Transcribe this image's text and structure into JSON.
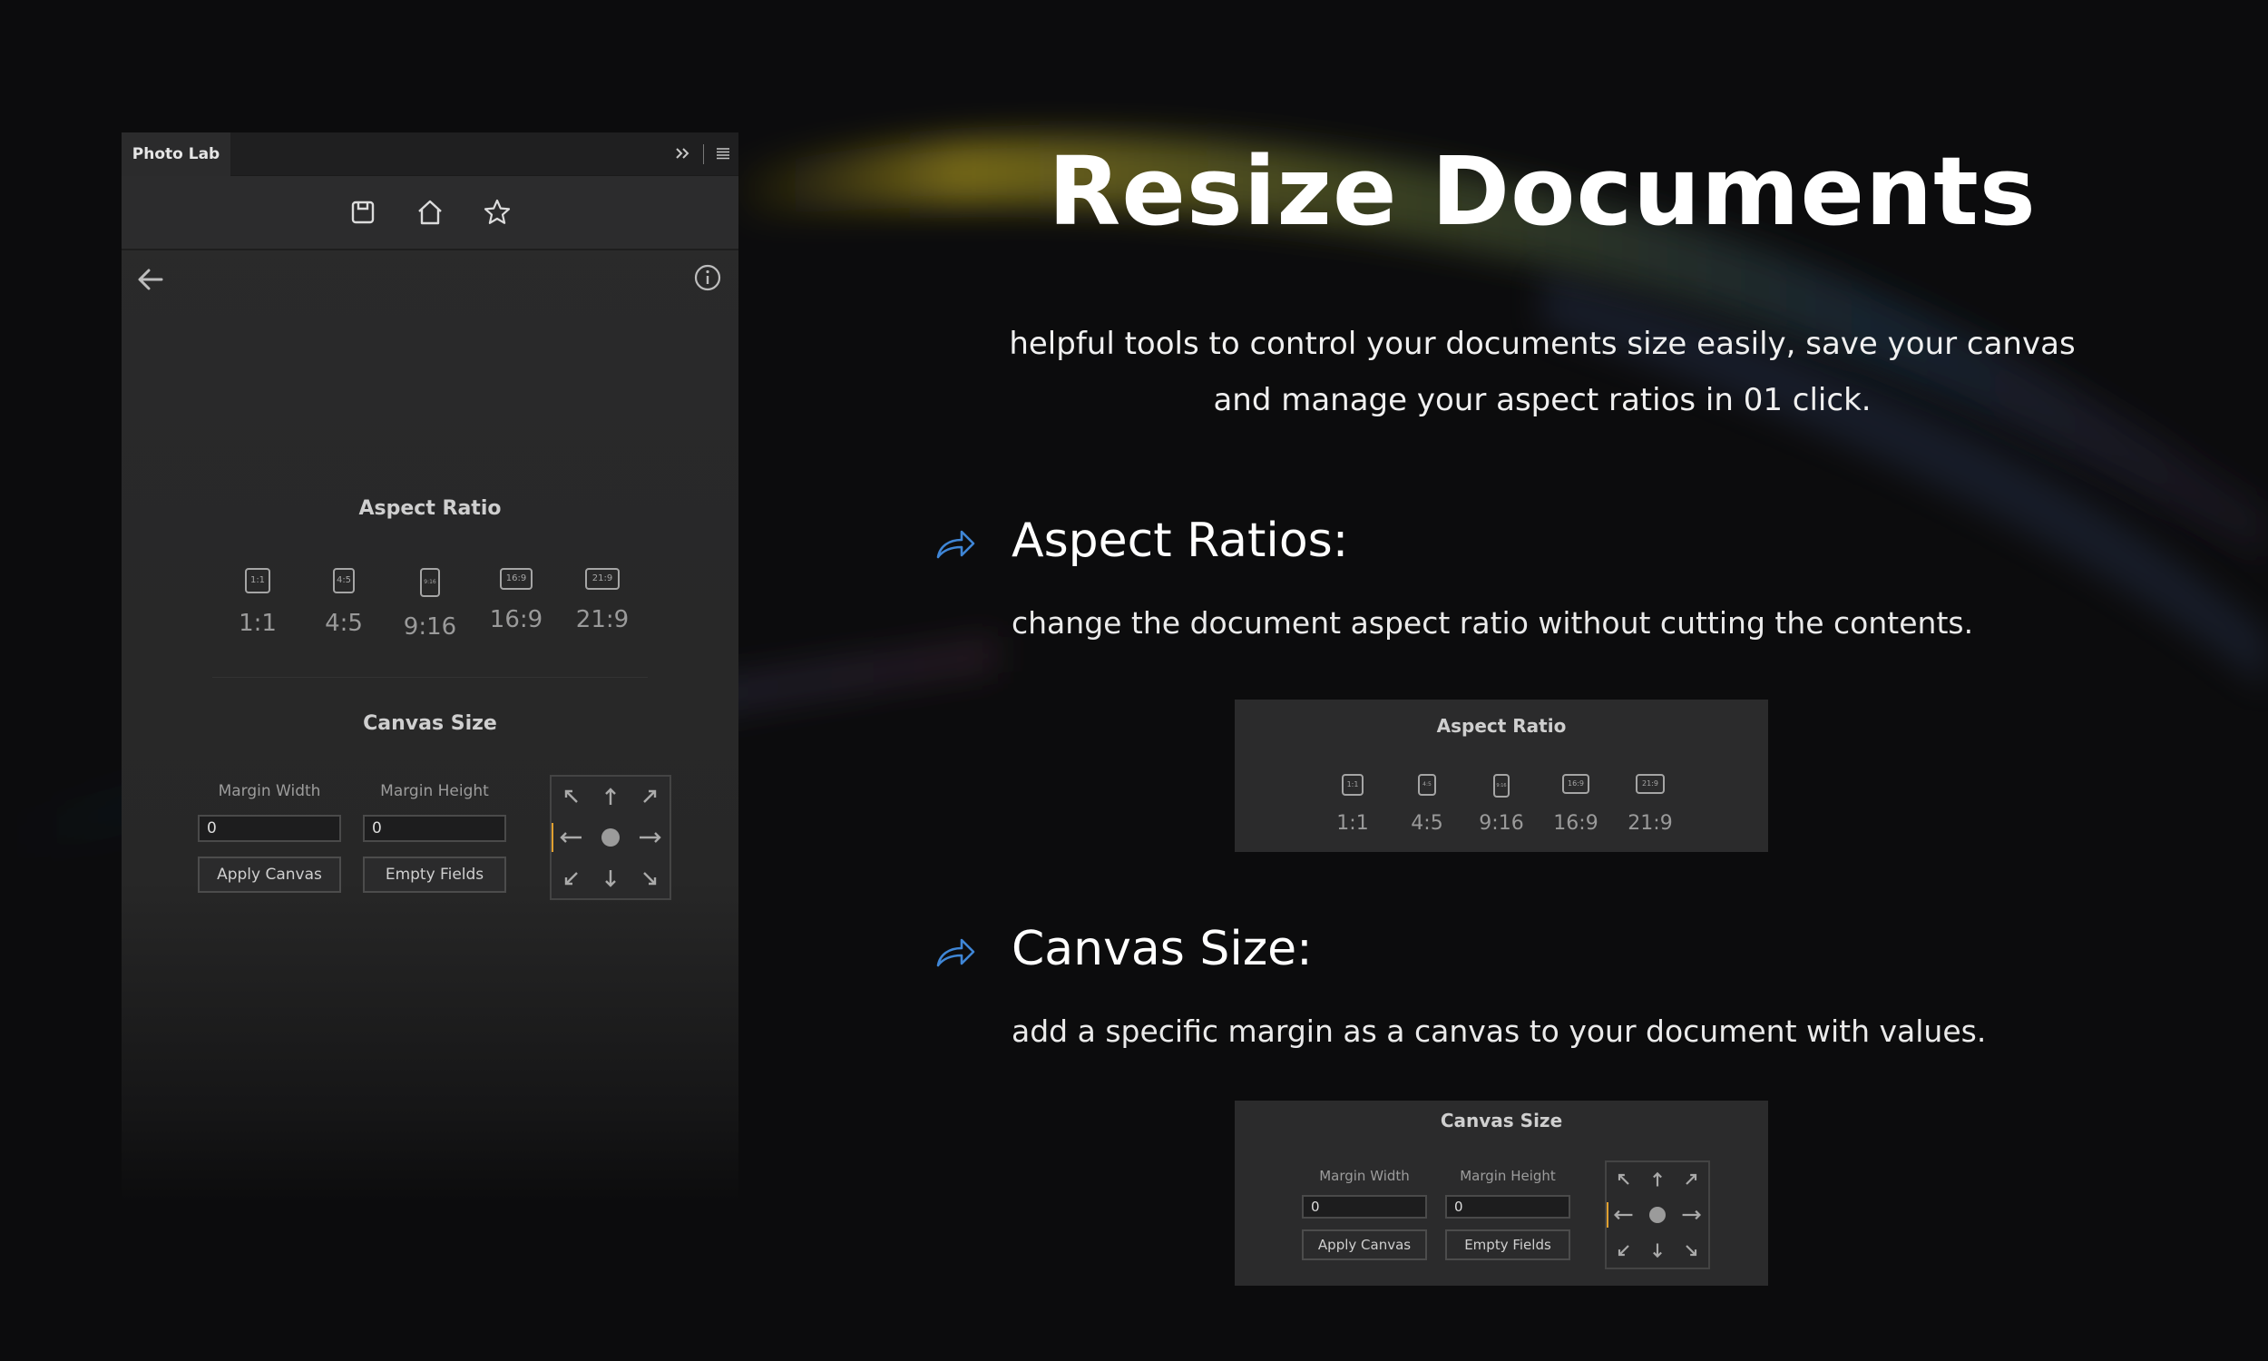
{
  "panel": {
    "tab_title": "Photo Lab",
    "toolbar_icons": [
      "save-icon",
      "home-icon",
      "star-icon"
    ],
    "aspect_ratio": {
      "title": "Aspect Ratio",
      "ratios": [
        {
          "icon_text": "1:1",
          "label": "1:1"
        },
        {
          "icon_text": "4:5",
          "label": "4:5"
        },
        {
          "icon_text": "9:16",
          "label": "9:16"
        },
        {
          "icon_text": "16:9",
          "label": "16:9"
        },
        {
          "icon_text": "21:9",
          "label": "21:9"
        }
      ]
    },
    "canvas_size": {
      "title": "Canvas Size",
      "margin_width_label": "Margin Width",
      "margin_height_label": "Margin Height",
      "margin_width_value": "0",
      "margin_height_value": "0",
      "apply_label": "Apply Canvas",
      "empty_label": "Empty Fields"
    }
  },
  "hero": {
    "title": "Resize Documents",
    "subtitle_line1": "helpful tools to control your documents size easily, save your canvas",
    "subtitle_line2": "and manage your aspect ratios in 01 click."
  },
  "features": [
    {
      "title": "Aspect Ratios:",
      "description": "change the document aspect ratio without cutting the contents."
    },
    {
      "title": "Canvas Size:",
      "description": "add a specific margin as a canvas to your document with values."
    }
  ],
  "colors": {
    "background": "#0c0c0d",
    "panel": "#2a2a2b",
    "accent_arrow": "#3f86d6",
    "anchor_active": "#e0a030"
  }
}
